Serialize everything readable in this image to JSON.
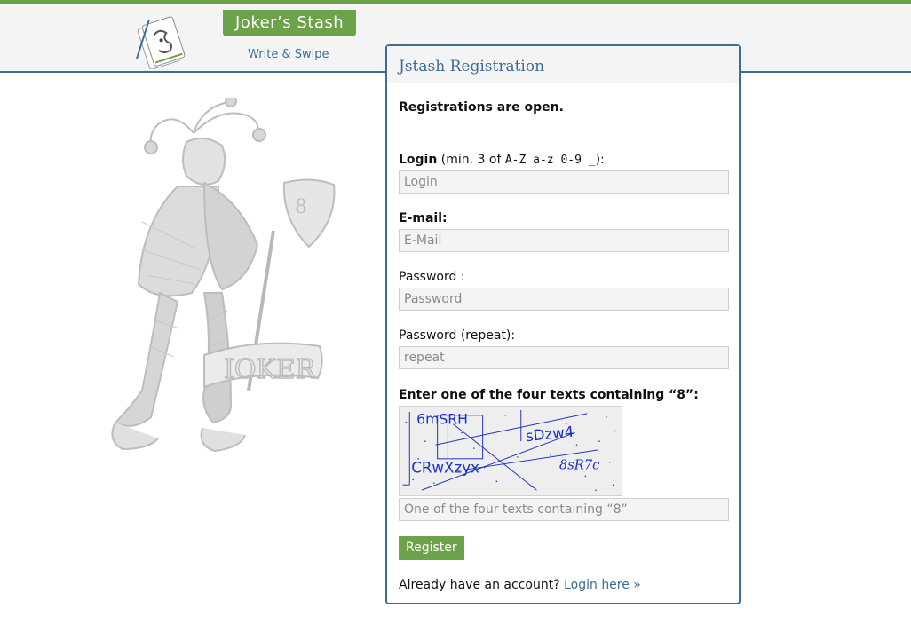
{
  "header": {
    "brand": "Joker’s Stash",
    "tagline": "Write & Swipe"
  },
  "colors": {
    "accent_green": "#6ca34a",
    "accent_blue": "#3d6d96",
    "panel_bg": "#f4f4f4"
  },
  "form": {
    "title": "Jstash Registration",
    "status": "Registrations are open.",
    "login": {
      "label": "Login",
      "hint_prefix": " (min. 3 of ",
      "hint_chars": "A-Z a-z 0-9 _",
      "hint_suffix": "):",
      "placeholder": "Login"
    },
    "email": {
      "label": "E-mail:",
      "placeholder": "E-Mail"
    },
    "password": {
      "label": "Password :",
      "placeholder": "Password"
    },
    "password_repeat": {
      "label": "Password (repeat):",
      "placeholder": "repeat"
    },
    "captcha": {
      "label": "Enter one of the four texts containing “8”:",
      "texts": [
        "6mSRH",
        "sDzw4",
        "CRwXzyx",
        "8sR7c"
      ],
      "placeholder": "One of the four texts containing “8”"
    },
    "submit_label": "Register",
    "footer_text": "Already have an account?",
    "footer_link": "Login here »"
  }
}
